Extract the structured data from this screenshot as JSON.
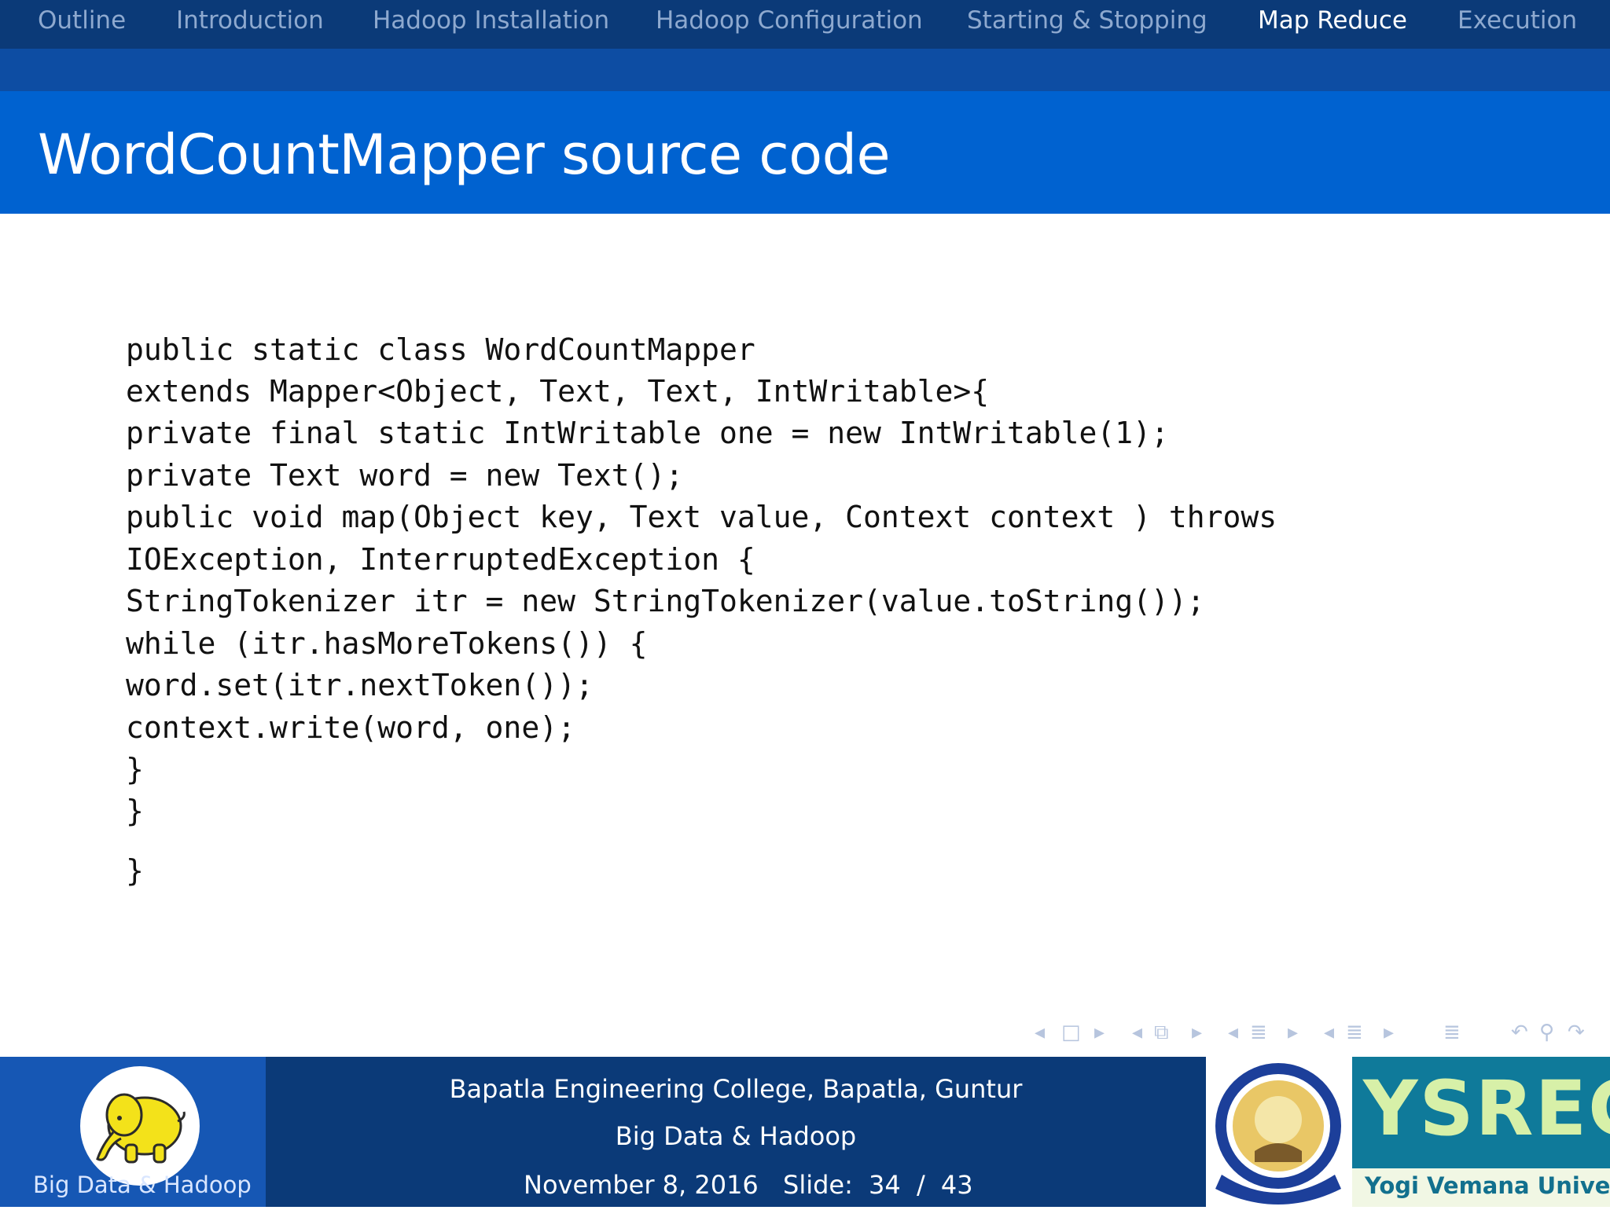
{
  "nav": {
    "items": [
      "Outline",
      "Introduction",
      "Hadoop Installation",
      "Hadoop Configuration",
      "Starting & Stopping",
      "Map Reduce",
      "Execution"
    ],
    "active": "Map Reduce"
  },
  "slide": {
    "title": "WordCountMapper source code",
    "code_lines": [
      "public static class WordCountMapper",
      "extends Mapper<Object, Text, Text, IntWritable>{",
      "private final static IntWritable one = new IntWritable(1);",
      "private Text word = new Text();",
      "public void map(Object key, Text value, Context context ) throws",
      "IOException, InterruptedException {",
      "StringTokenizer itr = new StringTokenizer(value.toString());",
      "while (itr.hasMoreTokens()) {",
      "word.set(itr.nextToken());",
      "context.write(word, one);",
      "}",
      "}",
      "}"
    ]
  },
  "beamer_nav_icons": [
    "nav-prev-slide-icon",
    "nav-slide-icon",
    "nav-next-slide-icon",
    "nav-prev-frame-icon",
    "nav-frame-icon",
    "nav-next-frame-icon",
    "nav-prev-subsection-icon",
    "nav-subsection-icon",
    "nav-next-subsection-icon",
    "nav-prev-section-icon",
    "nav-section-icon",
    "nav-next-section-icon",
    "nav-document-icon",
    "nav-back-icon",
    "nav-search-icon",
    "nav-forward-icon"
  ],
  "footer": {
    "brand": "Big Data & Hadoop",
    "institution": "Bapatla Engineering College, Bapatla, Guntur",
    "subtitle": "Big Data & Hadoop",
    "date": "November 8, 2016",
    "slide_label": "Slide:",
    "slide_current": "34",
    "slide_sep": "/",
    "slide_total": "43",
    "logo_text": "YSREC",
    "logo_subtext": "Yogi Vemana University"
  },
  "colors": {
    "nav_bg": "#0b3a78",
    "title_bg": "#0062d0",
    "nav_inactive": "#8ea9cf",
    "nav_active": "#ffffff"
  }
}
